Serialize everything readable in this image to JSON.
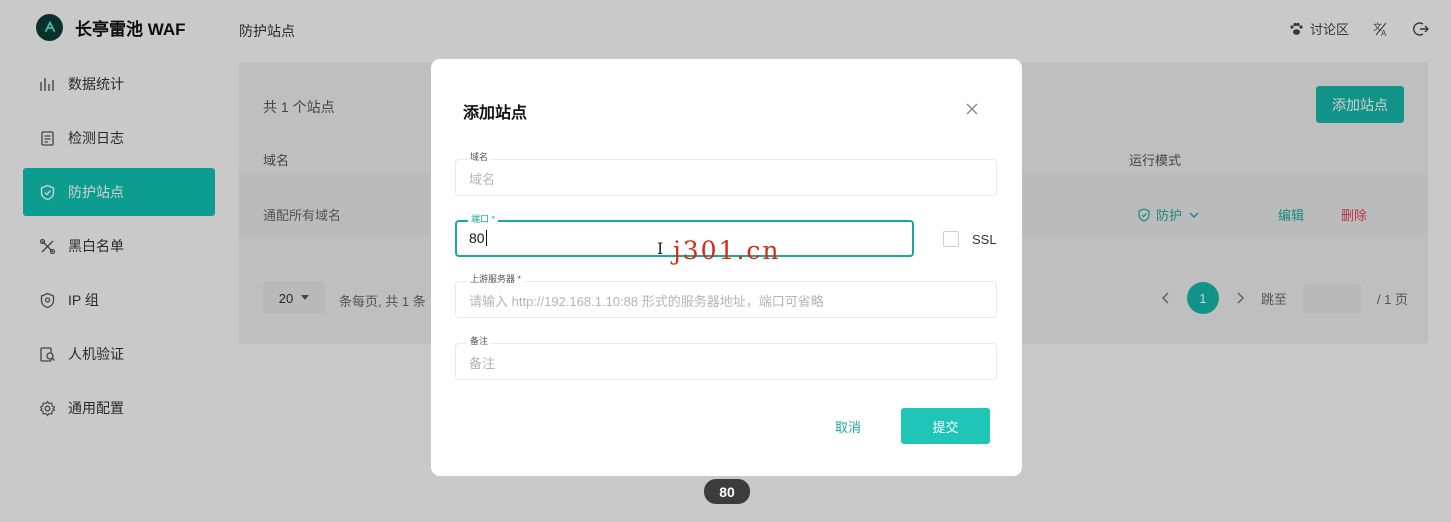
{
  "app": {
    "name": "长亭雷池 WAF",
    "brand_color": "#0d3b36",
    "accent": "#17b4a6"
  },
  "header": {
    "title": "防护站点",
    "forum_label": "讨论区",
    "forum_icon": "paw-icon",
    "lang_icon": "translate-icon",
    "logout_icon": "logout-icon"
  },
  "sidebar": {
    "items": [
      {
        "label": "数据统计",
        "icon": "bar-chart-icon",
        "active": false
      },
      {
        "label": "检测日志",
        "icon": "log-icon",
        "active": false
      },
      {
        "label": "防护站点",
        "icon": "shield-icon",
        "active": true
      },
      {
        "label": "黑白名单",
        "icon": "tools-icon",
        "active": false
      },
      {
        "label": "IP 组",
        "icon": "shield-ip-icon",
        "active": false
      },
      {
        "label": "人机验证",
        "icon": "captcha-icon",
        "active": false
      },
      {
        "label": "通用配置",
        "icon": "gear-icon",
        "active": false
      }
    ]
  },
  "main": {
    "count_label": "共 1 个站点",
    "add_button": "添加站点",
    "columns": {
      "domain": "域名",
      "mode": "运行模式"
    },
    "rows": [
      {
        "domain": "通配所有域名",
        "mode": "防护",
        "edit": "编辑",
        "delete": "删除"
      }
    ],
    "pagination": {
      "page_size": "20",
      "info": "条每页, 共 1 条",
      "current": "1",
      "goto_label": "跳至",
      "total_pages": "/ 1 页"
    }
  },
  "modal": {
    "title": "添加站点",
    "fields": {
      "domain": {
        "label": "域名",
        "placeholder": "域名",
        "value": ""
      },
      "port": {
        "label": "端口 *",
        "value": "80"
      },
      "upstream": {
        "label": "上游服务器 *",
        "placeholder": "请输入 http://192.168.1.10:88 形式的服务器地址，端口可省略",
        "value": ""
      },
      "note": {
        "label": "备注",
        "placeholder": "备注",
        "value": ""
      }
    },
    "ssl_label": "SSL",
    "cancel_label": "取消",
    "submit_label": "提交"
  },
  "watermark": "j301.cn",
  "toast": "80"
}
